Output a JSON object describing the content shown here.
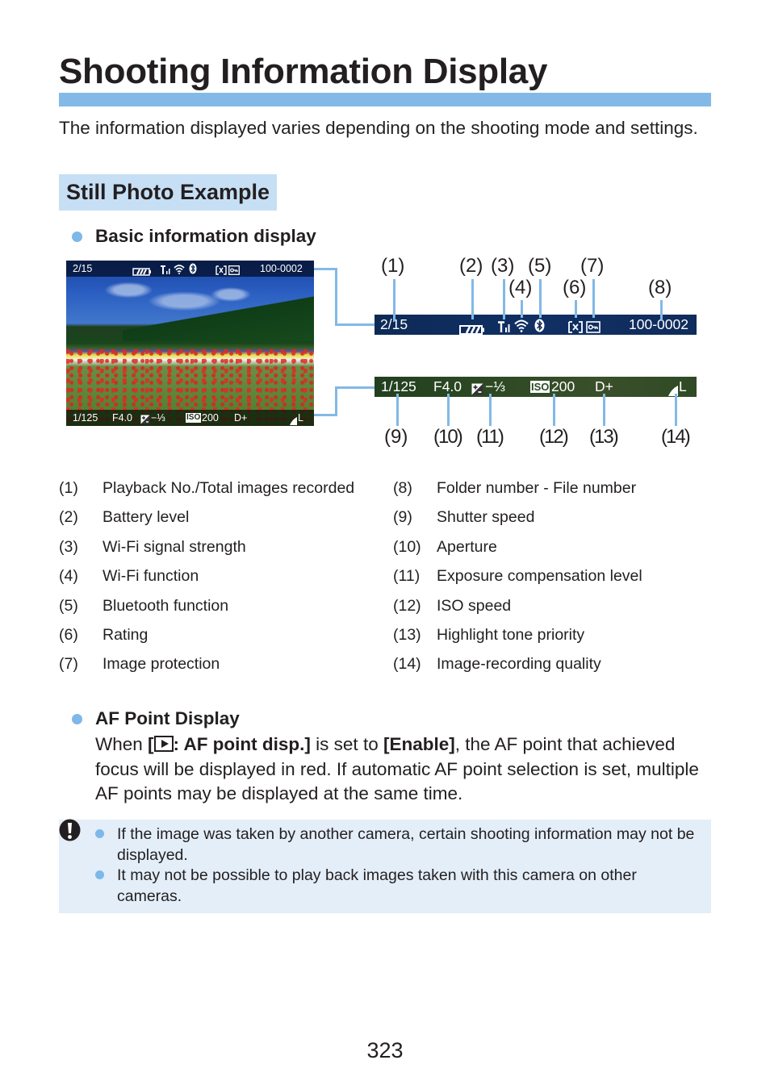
{
  "page": {
    "title": "Shooting Information Display",
    "intro": "The information displayed varies depending on the shooting mode and settings.",
    "section_heading": "Still Photo Example",
    "page_number": "323"
  },
  "basic_info": {
    "heading": "Basic information display",
    "osd_top": {
      "playback": "2/15",
      "folder_file": "100-0002"
    },
    "osd_bottom": {
      "shutter": "1/125",
      "aperture": "F4.0",
      "exposure_comp": "−⅓",
      "iso_label": "ISO",
      "iso_value": "200",
      "highlight_tone": "D+",
      "quality": "L"
    },
    "callouts_top": [
      "(1)",
      "(2)",
      "(3)",
      "(4)",
      "(5)",
      "(6)",
      "(7)",
      "(8)"
    ],
    "callouts_bottom": [
      "(9)",
      "(10)",
      "(11)",
      "(12)",
      "(13)",
      "(14)"
    ],
    "legend_left": [
      {
        "num": "(1)",
        "label": "Playback No./Total images recorded"
      },
      {
        "num": "(2)",
        "label": "Battery level"
      },
      {
        "num": "(3)",
        "label": "Wi-Fi signal strength"
      },
      {
        "num": "(4)",
        "label": "Wi-Fi function"
      },
      {
        "num": "(5)",
        "label": "Bluetooth function"
      },
      {
        "num": "(6)",
        "label": "Rating"
      },
      {
        "num": "(7)",
        "label": "Image protection"
      }
    ],
    "legend_right": [
      {
        "num": "(8)",
        "label": "Folder number - File number"
      },
      {
        "num": "(9)",
        "label": "Shutter speed"
      },
      {
        "num": "(10)",
        "label": "Aperture"
      },
      {
        "num": "(11)",
        "label": "Exposure compensation level"
      },
      {
        "num": "(12)",
        "label": "ISO speed"
      },
      {
        "num": "(13)",
        "label": "Highlight tone priority"
      },
      {
        "num": "(14)",
        "label": "Image-recording quality"
      }
    ]
  },
  "af_point": {
    "heading": "AF Point Display",
    "text_when": "When ",
    "bracket_open": "[",
    "menu_item": ": AF point disp.]",
    "text_mid": " is set to ",
    "setting": "[Enable]",
    "text_rest": ", the AF point that achieved focus will be displayed in red. If automatic AF point selection is set, multiple AF points may be displayed at the same time."
  },
  "caution": {
    "icon": "caution-icon",
    "items": [
      "If the image was taken by another camera, certain shooting information may not be displayed.",
      "It may not be possible to play back images taken with this camera on other cameras."
    ]
  },
  "colors": {
    "accent_bar": "#83b9e6",
    "section_bg": "#c7dff4",
    "bullet": "#7db8e8",
    "caution_bg": "#e3eef9"
  }
}
